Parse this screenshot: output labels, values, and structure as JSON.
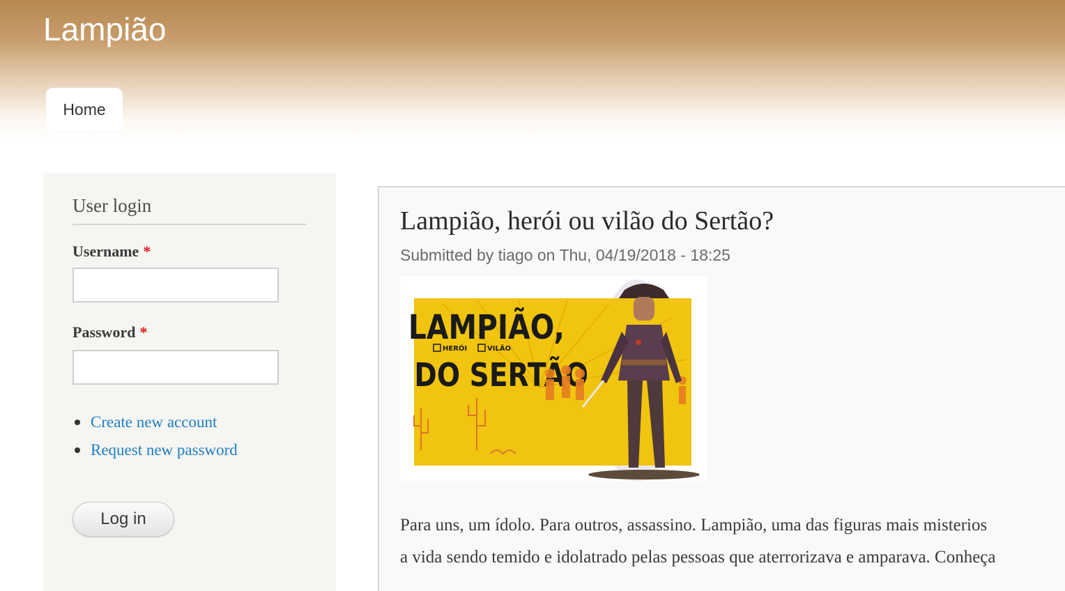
{
  "site": {
    "name": "Lampião"
  },
  "nav": {
    "tabs": [
      {
        "label": "Home",
        "active": true
      }
    ]
  },
  "sidebar": {
    "block_title": "User login",
    "username_label": "Username",
    "password_label": "Password",
    "required_mark": "*",
    "username_value": "",
    "password_value": "",
    "links": [
      {
        "label": "Create new account"
      },
      {
        "label": "Request new password"
      }
    ],
    "login_button": "Log in"
  },
  "article": {
    "title": "Lampião, herói ou vilão do Sertão?",
    "submitted": "Submitted by tiago on Thu, 04/19/2018 - 18:25",
    "image": {
      "line1": "LAMPIÃO,",
      "option1": "HERÓI",
      "option2": "VILÃO",
      "line2": "DO SERTÃO"
    },
    "body_lines": [
      "Para uns, um ídolo. Para outros, assassino. Lampião, uma das figuras mais misterios",
      "a vida sendo temido e idolatrado pelas pessoas que aterrorizava e amparava. Conheça"
    ]
  },
  "colors": {
    "header_top": "#b5884f",
    "link": "#1f7ec2",
    "required": "#e0191b",
    "poster_yellow": "#f1c40f"
  }
}
